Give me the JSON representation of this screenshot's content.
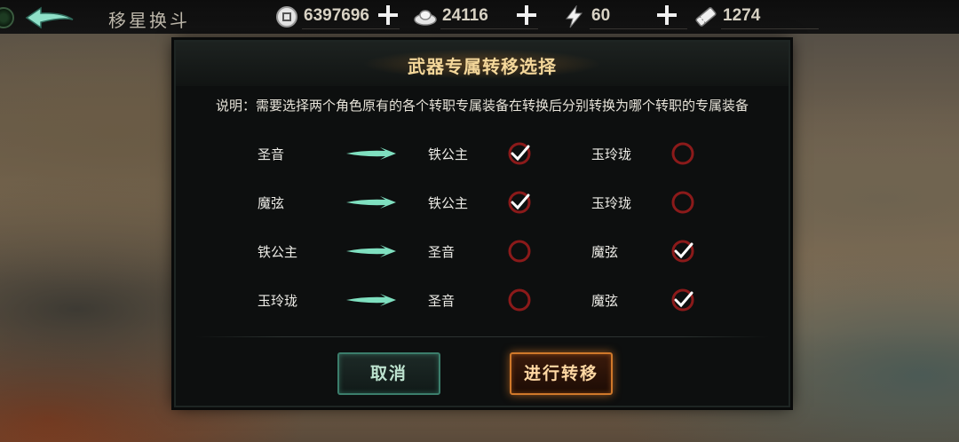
{
  "header": {
    "title": "移星换斗",
    "resources": [
      {
        "icon": "coin-icon",
        "value": "6397696"
      },
      {
        "icon": "ingot-icon",
        "value": "24116"
      },
      {
        "icon": "lightning-energy-icon",
        "value": "60"
      },
      {
        "icon": "ticket-icon",
        "value": "1274"
      }
    ]
  },
  "dialog": {
    "title": "武器专属转移选择",
    "description": "说明：需要选择两个角色原有的各个转职专属装备在转换后分别转换为哪个转职的专属装备",
    "rows": [
      {
        "source": "圣音",
        "option1": "铁公主",
        "option1_checked": true,
        "option2": "玉玲珑",
        "option2_checked": false
      },
      {
        "source": "魔弦",
        "option1": "铁公主",
        "option1_checked": true,
        "option2": "玉玲珑",
        "option2_checked": false
      },
      {
        "source": "铁公主",
        "option1": "圣音",
        "option1_checked": false,
        "option2": "魔弦",
        "option2_checked": true
      },
      {
        "source": "玉玲珑",
        "option1": "圣音",
        "option1_checked": false,
        "option2": "魔弦",
        "option2_checked": true
      }
    ],
    "cancel_label": "取消",
    "confirm_label": "进行转移"
  },
  "colors": {
    "title_gold": "#f4d79a",
    "arrow_teal": "#7fe0c0",
    "check_ring": "#8b1a1a",
    "confirm_orange": "#d0782a",
    "cancel_teal": "#3b7d6b"
  }
}
